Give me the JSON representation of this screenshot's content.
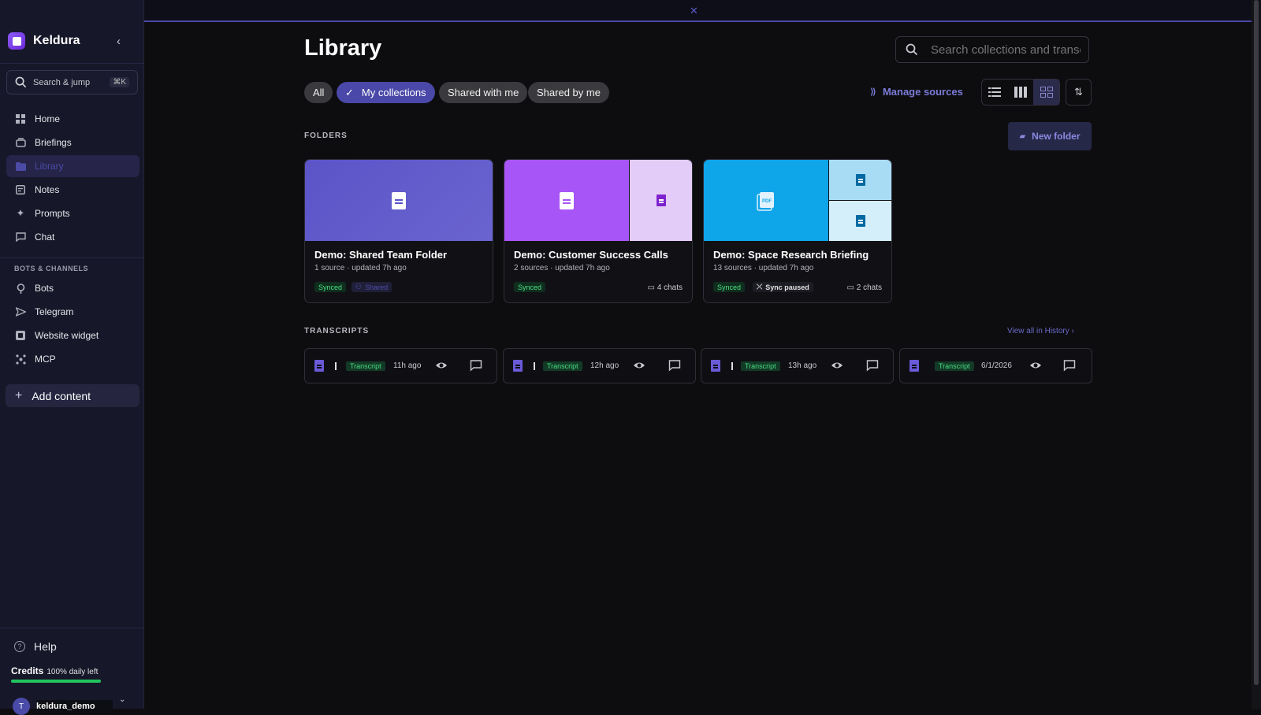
{
  "sidebar": {
    "brand": "Keldura",
    "search_label": "Search & jump",
    "search_shortcut": "⌘K",
    "nav": [
      {
        "label": "Home",
        "icon": "home-icon"
      },
      {
        "label": "Briefings",
        "icon": "briefings-icon"
      },
      {
        "label": "Library",
        "icon": "folder-icon",
        "active": true
      },
      {
        "label": "Notes",
        "icon": "notes-icon"
      },
      {
        "label": "Prompts",
        "icon": "sparkle-icon"
      },
      {
        "label": "Chat",
        "icon": "chat-icon"
      }
    ],
    "section_label": "BOTS & CHANNELS",
    "channels": [
      {
        "label": "Bots",
        "icon": "bot-icon"
      },
      {
        "label": "Telegram",
        "icon": "telegram-icon"
      },
      {
        "label": "Website widget",
        "icon": "widget-icon"
      },
      {
        "label": "MCP",
        "icon": "mcp-icon"
      }
    ],
    "add_content": "Add content",
    "help": "Help",
    "credits_label": "Credits",
    "credits_value": "100% daily left",
    "credits_fraction": 1.0,
    "user_initial": "T",
    "username": "keldura_demo"
  },
  "main": {
    "title": "Library",
    "search_placeholder": "Search collections and transcripts",
    "filters": [
      {
        "label": "All",
        "active": false
      },
      {
        "label": "My collections",
        "active": true
      },
      {
        "label": "Shared with me",
        "active": false
      },
      {
        "label": "Shared by me",
        "active": false
      }
    ],
    "manage_sources": "Manage sources",
    "folders_title": "FOLDERS",
    "new_folder": "New folder",
    "folders": [
      {
        "name": "Demo: Shared Team Folder",
        "meta": "1 source · updated 7h ago",
        "status": "Synced",
        "extra_badge": "Shared",
        "chats": ""
      },
      {
        "name": "Demo: Customer Success Calls",
        "meta": "2 sources · updated 7h ago",
        "status": "Synced",
        "extra_badge": "",
        "chats": "4 chats"
      },
      {
        "name": "Demo: Space Research Briefing",
        "meta": "13 sources · updated 7h ago",
        "status": "Synced",
        "extra_badge": "Sync paused",
        "chats": "2 chats"
      }
    ],
    "transcripts_title": "TRANSCRIPTS",
    "view_all": "View all in History",
    "transcripts": [
      {
        "tag": "Transcript",
        "time": "11h ago"
      },
      {
        "tag": "Transcript",
        "time": "12h ago"
      },
      {
        "tag": "Transcript",
        "time": "13h ago"
      },
      {
        "tag": "Transcript",
        "time": "6/1/2026"
      }
    ]
  },
  "colors": {
    "accent": "#4a48a8",
    "synced": "#4ade80",
    "folder1": "#5b54c8",
    "folder2": "#a855f7",
    "folder3": "#0ea5e9"
  }
}
